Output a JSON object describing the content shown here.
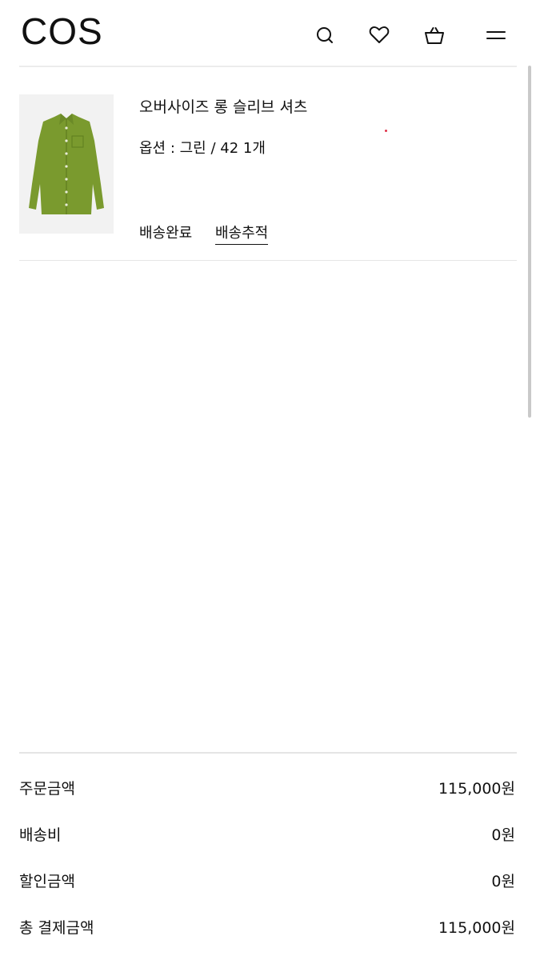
{
  "header": {
    "logo": "COS",
    "icons": [
      "search-icon",
      "heart-icon",
      "shopping-bag-icon",
      "menu-icon"
    ]
  },
  "order_item": {
    "name": "오버사이즈 롱 슬리브 셔츠",
    "option": "옵션 : 그린 / 42 1개",
    "status": "배송완료",
    "track_label": "배송추적",
    "image_color": "#7a9a2e"
  },
  "summary": {
    "rows": [
      {
        "label": "주문금액",
        "value": "115,000원"
      },
      {
        "label": "배송비",
        "value": "0원"
      },
      {
        "label": "할인금액",
        "value": "0원"
      },
      {
        "label": "총 결제금액",
        "value": "115,000원"
      }
    ]
  }
}
